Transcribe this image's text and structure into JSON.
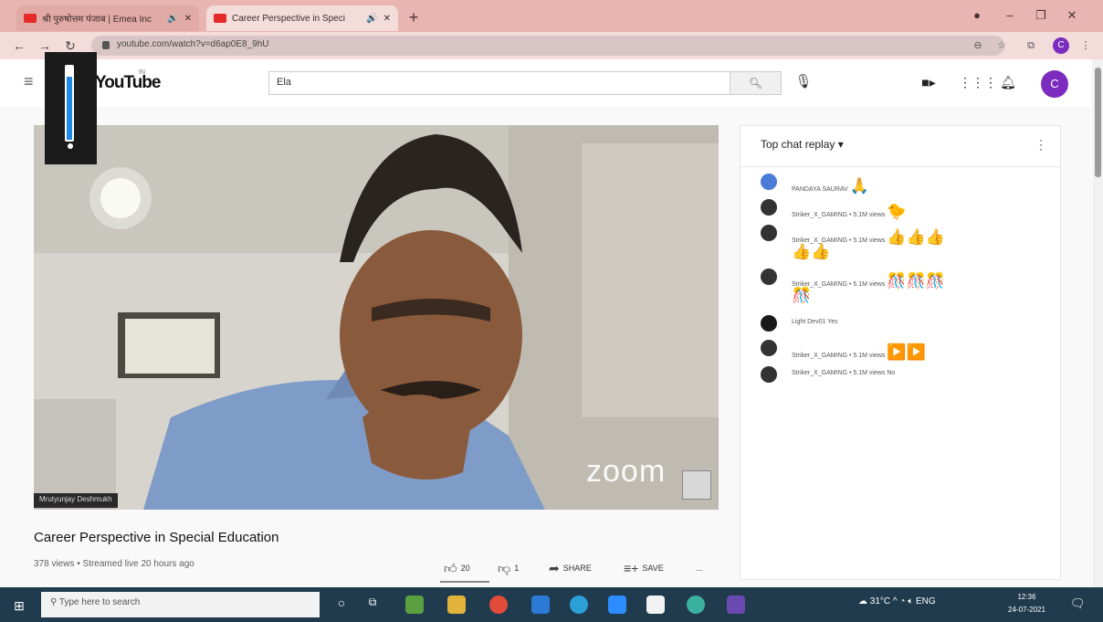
{
  "browser": {
    "tabs": [
      {
        "label": "श्री पुरुषोत्तम पंजाब | Emea Inc"
      },
      {
        "label": "Career Perspective in Speci"
      }
    ],
    "url": "youtube.com/watch?v=d6ap0E8_9hU"
  },
  "header": {
    "logo": "YouTube",
    "logo_sup": "IN",
    "search_value": "Ela",
    "avatar_letter": "C"
  },
  "video": {
    "nameplate": "Mrutyunjay Deshmukh",
    "watermark": "zoom",
    "volume_level": 0.86,
    "title": "Career Perspective in Special Education",
    "meta": "378 views • Streamed live 20 hours ago",
    "likes": "20",
    "dislikes": "1",
    "share": "SHARE",
    "save": "SAVE",
    "more": "..."
  },
  "chat": {
    "title": "Top chat replay ▾",
    "more": "⋮",
    "messages": [
      {
        "author": "PANDAYA SAURAV",
        "emojis": "🙏",
        "avatar_color": "#4a7bd6"
      },
      {
        "author": "Striker_X_GAMING • 5.1M views",
        "emojis": "🐤",
        "avatar_color": "#2e2e2e"
      },
      {
        "author": "Striker_X_GAMING • 5.1M views",
        "emojis": "👍👍👍",
        "emojis_wrap": "👍👍",
        "avatar_color": "#2e2e2e"
      },
      {
        "author": "Striker_X_GAMING • 5.1M views",
        "emojis": "🎊🎊🎊",
        "emojis_wrap": "🎊",
        "avatar_color": "#2e2e2e"
      },
      {
        "author": "Light Dev01 Yes",
        "emojis": "",
        "avatar_color": "#1a1a1a"
      },
      {
        "author": "Striker_X_GAMING • 5.1M views",
        "emojis": "▶️▶️",
        "avatar_color": "#2e2e2e"
      },
      {
        "author": "Striker_X_GAMING • 5.1M views",
        "emojis": "No",
        "avatar_color": "#2e2e2e"
      }
    ]
  },
  "taskbar": {
    "search_placeholder": "Type here to search",
    "weather": "31°C",
    "lang": "ENG",
    "time": "12:36",
    "date": "24-07-2021"
  }
}
